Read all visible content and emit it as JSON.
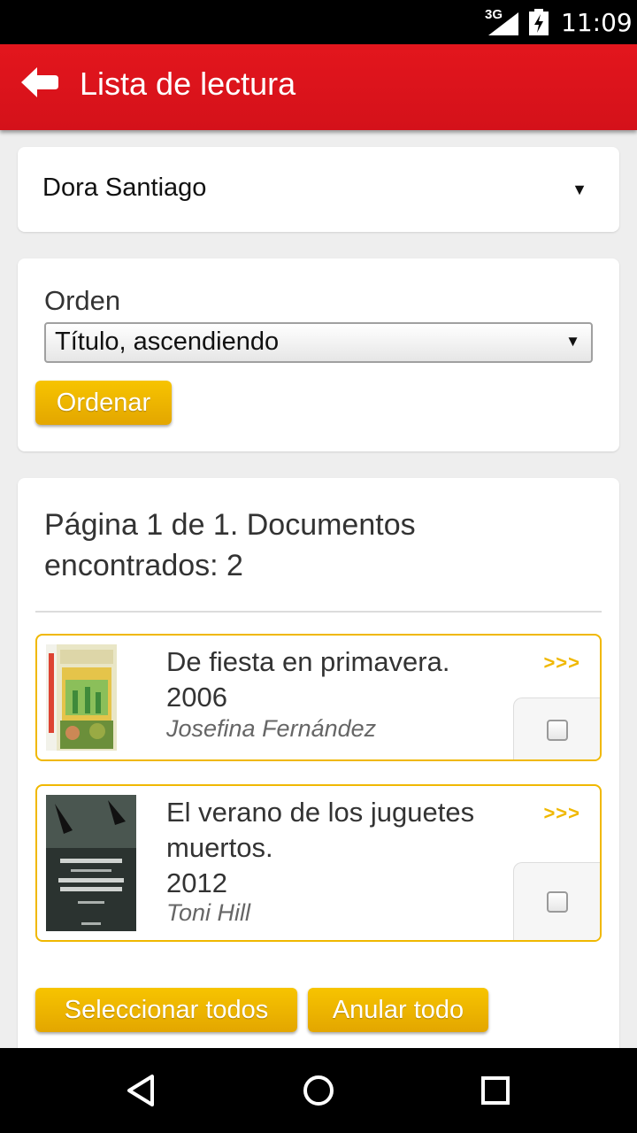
{
  "status_bar": {
    "network": "3G",
    "time": "11:09"
  },
  "header": {
    "title": "Lista de lectura",
    "back_icon": "back-arrow-icon"
  },
  "user_select": {
    "value": "Dora Santiago"
  },
  "sort": {
    "label": "Orden",
    "selected": "Título, ascendiendo",
    "button": "Ordenar"
  },
  "results": {
    "summary": "Página 1 de 1. Documentos encontrados: 2",
    "items": [
      {
        "title": "De fiesta en primavera.",
        "year": "2006",
        "author": "Josefina Fernández",
        "more": ">>>",
        "checked": false
      },
      {
        "title": "El verano de los juguetes muertos.",
        "year": "2012",
        "author": "Toni Hill",
        "more": ">>>",
        "checked": false
      }
    ],
    "select_all": "Seleccionar todos",
    "clear_all": "Anular todo"
  },
  "colors": {
    "header": "#e3161d",
    "accent": "#f0b800"
  }
}
